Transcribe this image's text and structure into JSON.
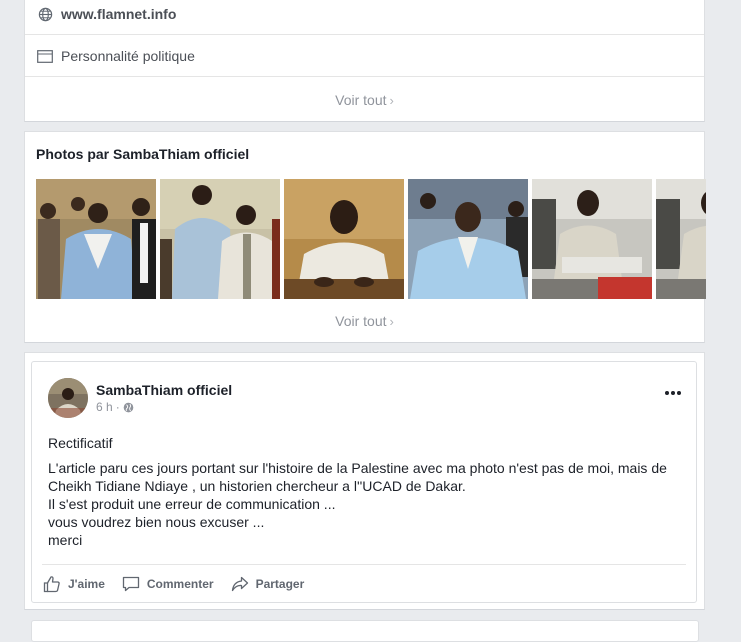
{
  "info": {
    "website": "www.flamnet.info",
    "category": "Personnalité politique",
    "see_all": "Voir tout"
  },
  "photos": {
    "title": "Photos par SambaThiam officiel",
    "see_all": "Voir tout"
  },
  "post": {
    "author": "SambaThiam officiel",
    "time": "6 h",
    "separator": "·",
    "title": "Rectificatif",
    "body": [
      "L'article paru ces jours portant sur l'histoire de la Palestine avec ma photo n'est pas de moi, mais de Cheikh Tidiane Ndiaye , un historien chercheur a l''UCAD de Dakar.",
      "Il s'est produit une erreur de communication ...",
      "vous voudrez bien nous excuser ...",
      "merci"
    ],
    "actions": {
      "like": "J'aime",
      "comment": "Commenter",
      "share": "Partager"
    },
    "more_icon": "more-options-icon"
  },
  "colors": {
    "background": "#e9ebee",
    "text_primary": "#1d2129",
    "text_secondary": "#90949c",
    "action_text": "#616770"
  }
}
